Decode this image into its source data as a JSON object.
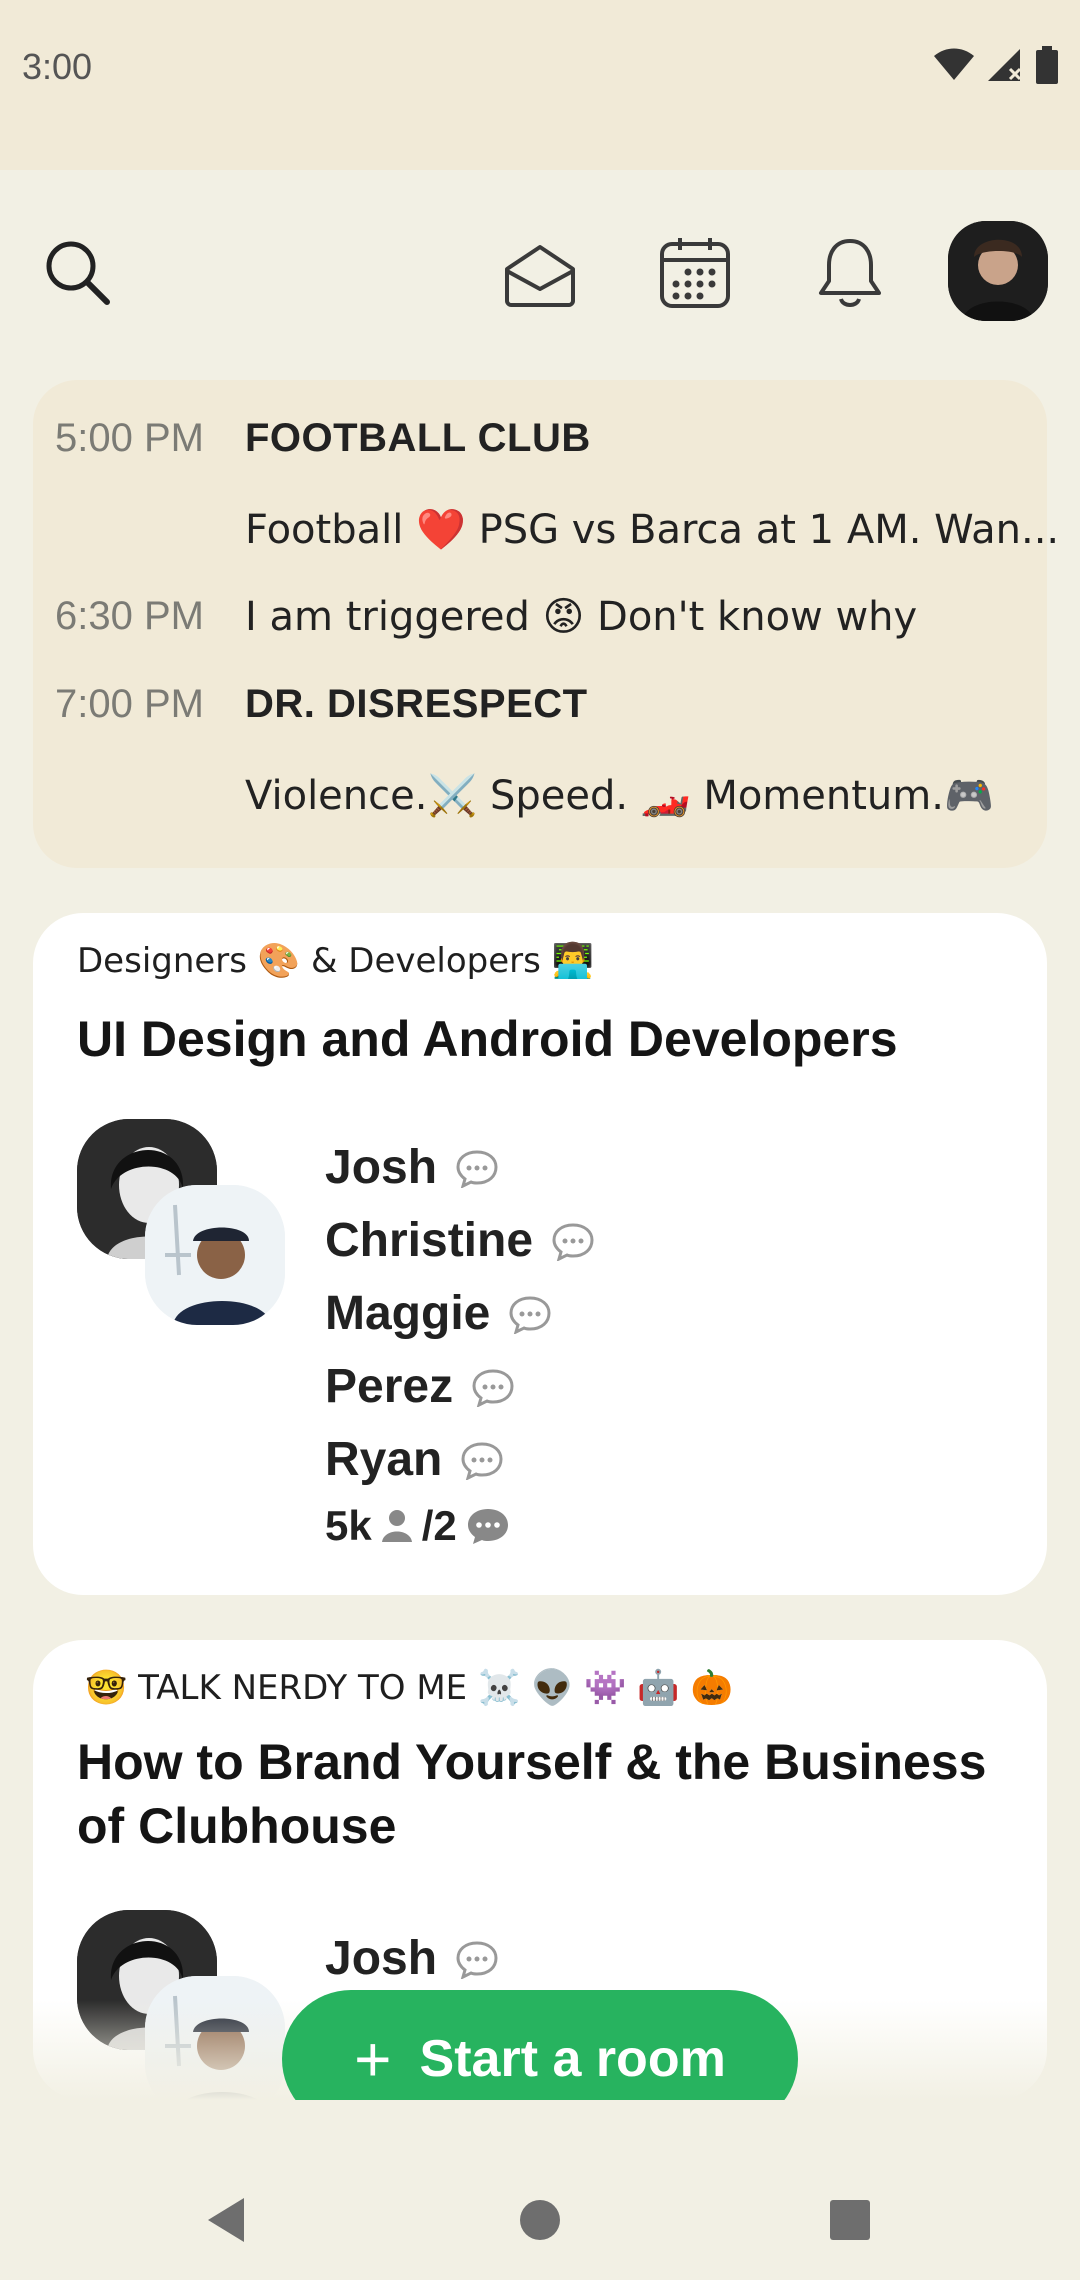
{
  "status": {
    "time": "3:00"
  },
  "nav": {
    "icons": [
      "search-icon",
      "envelope-icon",
      "calendar-icon",
      "bell-icon",
      "profile-avatar"
    ]
  },
  "upcoming": [
    {
      "time": "5:00 PM",
      "title": "FOOTBALL CLUB",
      "desc": "Football ❤️ PSG vs Barca at 1 AM. Wan..."
    },
    {
      "time": "6:30 PM",
      "title": "",
      "desc": "I am triggered 😡 Don't know why"
    },
    {
      "time": "7:00 PM",
      "title": "DR. DISRESPECT",
      "desc": "Violence.⚔️  Speed. 🏎️  Momentum.🎮"
    }
  ],
  "rooms": [
    {
      "club": "Designers 🎨 & Developers 👨‍💻",
      "title": "UI Design and Android Developers",
      "speakers": [
        "Josh",
        "Christine",
        "Maggie",
        "Perez",
        "Ryan"
      ],
      "listeners": "5k",
      "speaking": "2"
    },
    {
      "club": "🤓 TALK NERDY TO ME ☠️ 👽 👾 🤖 🎃",
      "title": "How to Brand Yourself & the Business of Clubhouse",
      "speakers": [
        "Josh"
      ]
    }
  ],
  "actions": {
    "start_room": "Start a room",
    "start_room_icon": "plus-icon"
  },
  "colors": {
    "background": "#f2f0e4",
    "card": "#ffffff",
    "upcoming_bg": "#f1ead7",
    "accent_green": "#27b35f"
  }
}
